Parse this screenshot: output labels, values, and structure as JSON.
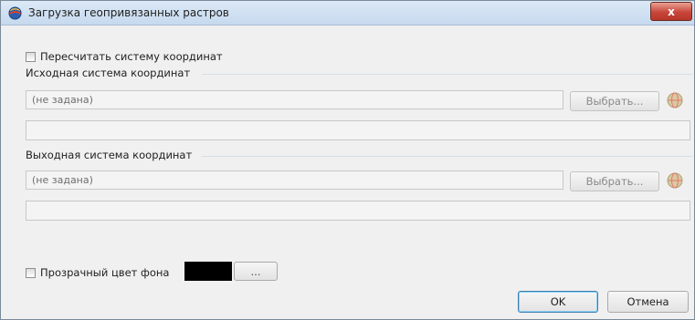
{
  "window": {
    "title": "Загрузка геопривязанных растров",
    "close_label": "x"
  },
  "recalc": {
    "label": "Пересчитать систему координат",
    "checked": false
  },
  "source_cs": {
    "group_label": "Исходная система координат",
    "value": "(не задана)",
    "select_label": "Выбрать...",
    "details": ""
  },
  "target_cs": {
    "group_label": "Выходная система координат",
    "value": "(не задана)",
    "select_label": "Выбрать...",
    "details": ""
  },
  "transparency": {
    "label": "Прозрачный цвет фона",
    "checked": false,
    "color": "#000000",
    "pick_label": "..."
  },
  "footer": {
    "ok_label": "OK",
    "cancel_label": "Отмена"
  },
  "icons": {
    "app": "app-globe-icon",
    "globe": "globe-icon"
  }
}
